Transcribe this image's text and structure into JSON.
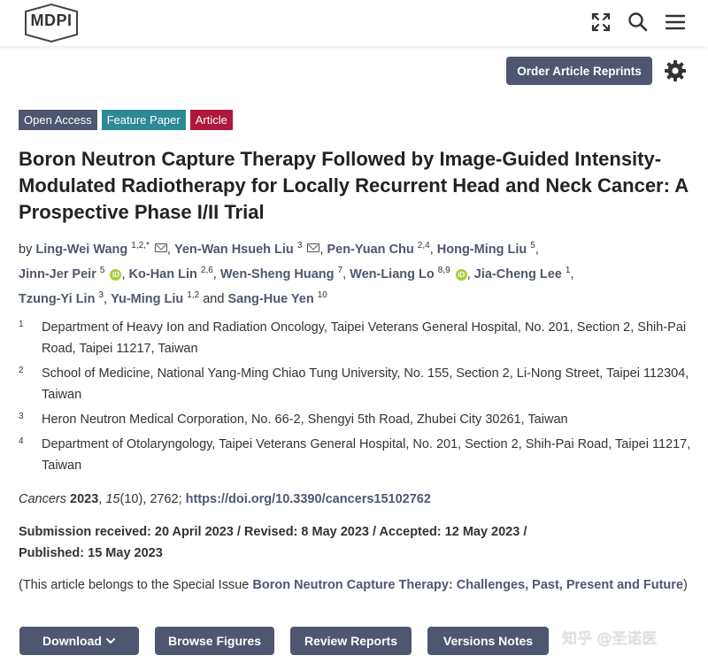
{
  "header": {
    "logo_text": "MDPI",
    "order_button": "Order Article Reprints"
  },
  "badges": [
    "Open Access",
    "Feature Paper",
    "Article"
  ],
  "title": "Boron Neutron Capture Therapy Followed by Image-Guided Intensity-Modulated Radiotherapy for Locally Recurrent Head and Neck Cancer: A Prospective Phase I/II Trial",
  "authors": {
    "by": "by",
    "list": [
      {
        "name": "Ling-Wei Wang",
        "sup": "1,2,*"
      },
      {
        "name": "Yen-Wan Hsueh Liu",
        "sup": "3"
      },
      {
        "name": "Pen-Yuan Chu",
        "sup": "2,4"
      },
      {
        "name": "Hong-Ming Liu",
        "sup": "5"
      },
      {
        "name": "Jinn-Jer Peir",
        "sup": "5"
      },
      {
        "name": "Ko-Han Lin",
        "sup": "2,6"
      },
      {
        "name": "Wen-Sheng Huang",
        "sup": "7"
      },
      {
        "name": "Wen-Liang Lo",
        "sup": "8,9"
      },
      {
        "name": "Jia-Cheng Lee",
        "sup": "1"
      },
      {
        "name": "Tzung-Yi Lin",
        "sup": "3"
      },
      {
        "name": "Yu-Ming Liu",
        "sup": "1,2"
      },
      {
        "name": "Sang-Hue Yen",
        "sup": "10"
      }
    ],
    "and": "and",
    "orcid_label": "iD"
  },
  "affiliations": [
    {
      "num": "1",
      "text": "Department of Heavy Ion and Radiation Oncology, Taipei Veterans General Hospital, No. 201, Section 2, Shih-Pai Road, Taipei 11217, Taiwan"
    },
    {
      "num": "2",
      "text": "School of Medicine, National Yang-Ming Chiao Tung University, No. 155, Section 2, Li-Nong Street, Taipei 112304, Taiwan"
    },
    {
      "num": "3",
      "text": "Heron Neutron Medical Corporation, No. 66-2, Shengyi 5th Road, Zhubei City 30261, Taiwan"
    },
    {
      "num": "4",
      "text": "Department of Otolaryngology, Taipei Veterans General Hospital, No. 201, Section 2, Shih-Pai Road, Taipei 11217, Taiwan"
    }
  ],
  "citation": {
    "journal": "Cancers",
    "year": "2023",
    "volume": "15",
    "issue_pages": "(10), 2762;",
    "doi": "https://doi.org/10.3390/cancers15102762"
  },
  "dates": {
    "line1": "Submission received: 20 April 2023 / Revised: 8 May 2023 / Accepted: 12 May 2023 /",
    "line2": "Published: 15 May 2023"
  },
  "special_issue": {
    "prefix": "(This article belongs to the Special Issue ",
    "name": "Boron Neutron Capture Therapy: Challenges, Past, Present and Future",
    "suffix": ")"
  },
  "actions": {
    "download": "Download",
    "browse": "Browse Figures",
    "review": "Review Reports",
    "versions": "Versions Notes"
  },
  "watermark": "知乎 @圣诺医",
  "colors": {
    "primary": "#4f5671",
    "feature": "#2b8a96",
    "article": "#b0173c",
    "orcid": "#a6ce39"
  }
}
